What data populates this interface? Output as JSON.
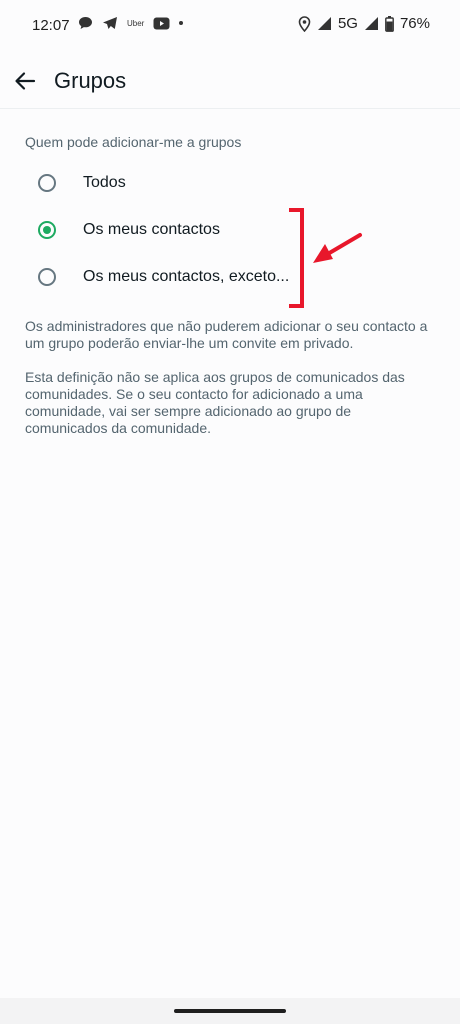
{
  "status_bar": {
    "time": "12:07",
    "uber_label": "Uber",
    "network": "5G",
    "battery": "76%",
    "icons": [
      "chat-bubble-icon",
      "telegram-icon",
      "uber-icon",
      "youtube-icon",
      "more-notifications-dot",
      "location-icon",
      "signal-icon",
      "battery-icon"
    ]
  },
  "app_bar": {
    "title": "Grupos",
    "back_icon": "arrow-left-icon"
  },
  "section": {
    "heading": "Quem pode adicionar-me a grupos",
    "options": [
      {
        "label": "Todos",
        "selected": false
      },
      {
        "label": "Os meus contactos",
        "selected": true
      },
      {
        "label": "Os meus contactos, exceto...",
        "selected": false
      }
    ],
    "description_1": "Os administradores que não puderem adicionar o seu contacto a um grupo poderão enviar-lhe um convite em privado.",
    "description_2": "Esta definição não se aplica aos grupos de comunicados das comunidades. Se o seu contacto for adicionado a uma comunidade, vai ser sempre adicionado ao grupo de comunicados da comunidade."
  },
  "colors": {
    "accent": "#1daa61",
    "annotation": "#e8172b",
    "secondary_text": "#54656f"
  }
}
